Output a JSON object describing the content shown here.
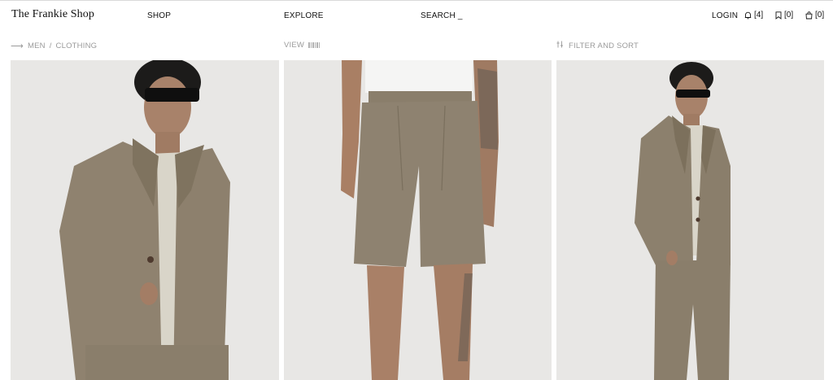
{
  "brand": {
    "name": "The Frankie Shop"
  },
  "nav": {
    "shop": "SHOP",
    "explore": "EXPLORE",
    "search": "SEARCH _",
    "login": "LOGIN",
    "notifications": "[4]",
    "saved": "[0]",
    "bag": "[0]"
  },
  "breadcrumb": {
    "men": "MEN",
    "separator": "/",
    "clothing": "CLOTHING"
  },
  "toolbar": {
    "view_label": "VIEW",
    "filter_label": "FILTER AND SORT"
  },
  "products": [
    {
      "name": "product-jacket",
      "color": "#8f826f"
    },
    {
      "name": "product-shorts",
      "color": "#8e8270"
    },
    {
      "name": "product-suit",
      "color": "#8c806d"
    }
  ],
  "colors": {
    "background": "#ffffff",
    "photo_bg": "#e8e7e5",
    "muted_text": "#9a9a9a",
    "text": "#111111"
  }
}
